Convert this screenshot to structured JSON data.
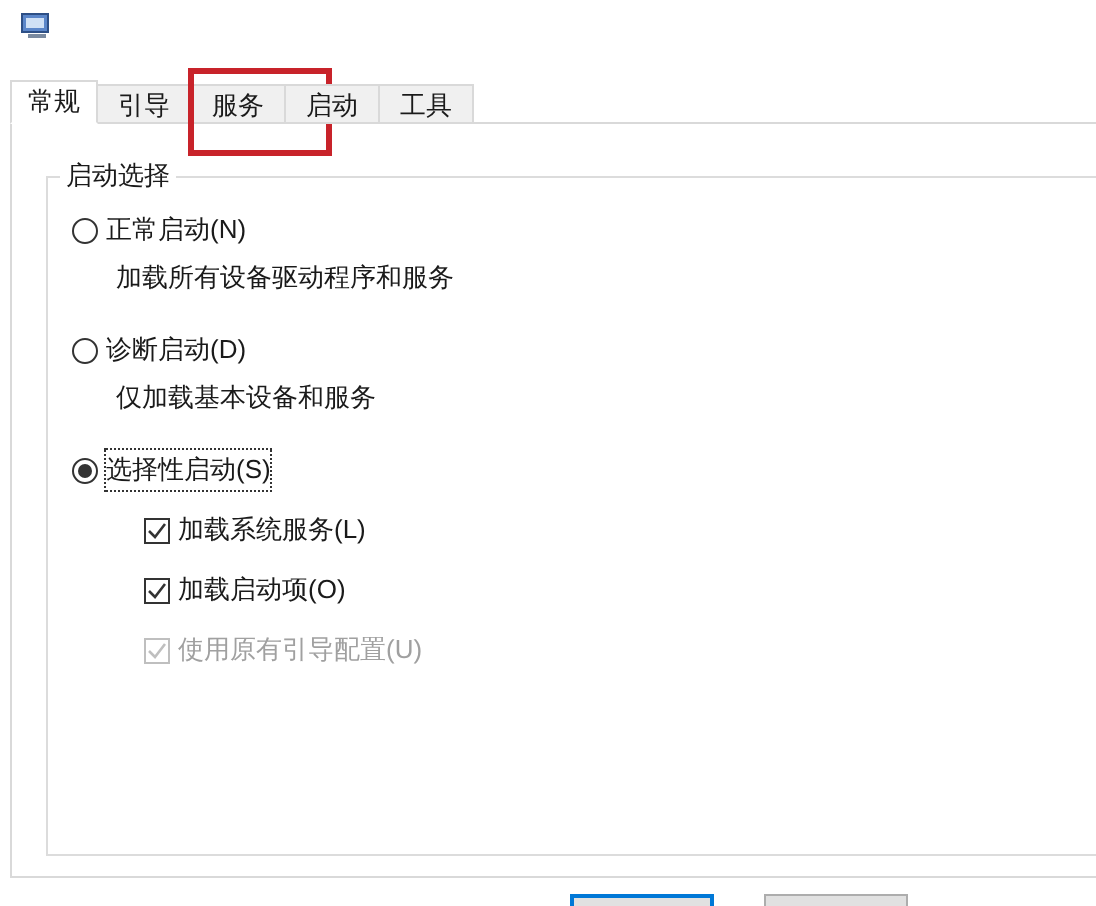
{
  "tabs": [
    {
      "label": "常规",
      "selected": true,
      "highlighted": false
    },
    {
      "label": "引导",
      "selected": false,
      "highlighted": false
    },
    {
      "label": "服务",
      "selected": false,
      "highlighted": true
    },
    {
      "label": "启动",
      "selected": false,
      "highlighted": false
    },
    {
      "label": "工具",
      "selected": false,
      "highlighted": false
    }
  ],
  "group": {
    "title": "启动选择",
    "options": [
      {
        "label": "正常启动(N)",
        "selected": false,
        "focused": false,
        "description": "加载所有设备驱动程序和服务"
      },
      {
        "label": "诊断启动(D)",
        "selected": false,
        "focused": false,
        "description": "仅加载基本设备和服务"
      },
      {
        "label": "选择性启动(S)",
        "selected": true,
        "focused": true
      }
    ],
    "checkboxes": [
      {
        "label": "加载系统服务(L)",
        "checked": true,
        "disabled": false
      },
      {
        "label": "加载启动项(O)",
        "checked": true,
        "disabled": false
      },
      {
        "label": "使用原有引导配置(U)",
        "checked": true,
        "disabled": true
      }
    ]
  }
}
